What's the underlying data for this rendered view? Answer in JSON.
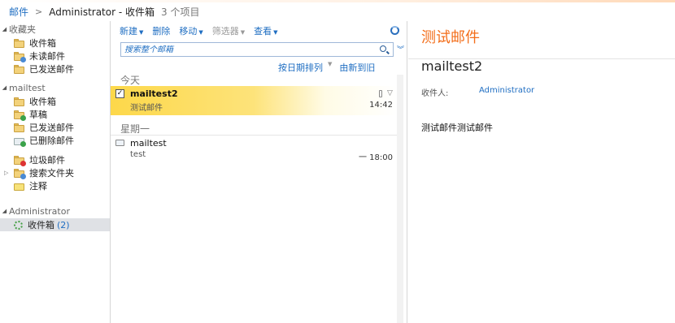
{
  "breadcrumb": {
    "root": "邮件",
    "current": "Administrator - 收件箱",
    "count": "3 个项目"
  },
  "nav": {
    "favorites": {
      "title": "收藏夹",
      "items": [
        {
          "label": "收件箱",
          "icon": "inbox-folder-icon"
        },
        {
          "label": "未读邮件",
          "icon": "unread-folder-icon"
        },
        {
          "label": "已发送邮件",
          "icon": "sent-folder-icon"
        }
      ]
    },
    "account": {
      "title": "mailtest",
      "items": [
        {
          "label": "收件箱",
          "icon": "inbox-folder-icon"
        },
        {
          "label": "草稿",
          "icon": "drafts-folder-icon"
        },
        {
          "label": "已发送邮件",
          "icon": "sent-folder-icon"
        },
        {
          "label": "已删除邮件",
          "icon": "recycle-bin-icon"
        }
      ],
      "extra": [
        {
          "label": "垃圾邮件",
          "icon": "junk-folder-icon"
        },
        {
          "label": "搜索文件夹",
          "icon": "search-folder-icon"
        },
        {
          "label": "注释",
          "icon": "notes-icon"
        }
      ]
    },
    "shared": {
      "title": "Administrator",
      "item": {
        "label": "收件箱",
        "count_open": "(",
        "count": "2",
        "count_close": ")"
      }
    }
  },
  "toolbar": {
    "new": "新建",
    "delete": "删除",
    "move": "移动",
    "filter": "筛选器",
    "view": "查看"
  },
  "search": {
    "placeholder": "搜索整个邮箱"
  },
  "sort": {
    "by": "按日期排列",
    "order": "由新到旧"
  },
  "groups": [
    {
      "label": "今天",
      "messages": [
        {
          "sender": "mailtest2",
          "subject": "测试邮件",
          "time": "14:42",
          "selected": true,
          "unread": true
        }
      ]
    },
    {
      "label": "星期一",
      "messages": [
        {
          "sender": "mailtest",
          "subject": "test",
          "time": "一 18:00",
          "selected": false,
          "unread": false
        }
      ]
    }
  ],
  "reading": {
    "title": "测试邮件",
    "subject": "mailtest2",
    "to_label": "收件人:",
    "to_value": "Administrator",
    "body": "测试邮件测试邮件"
  },
  "colors": {
    "accent": "#f36d19",
    "link": "#1f6ec2",
    "selection": "#fdd84a"
  }
}
